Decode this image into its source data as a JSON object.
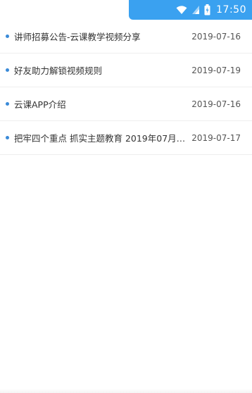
{
  "status_bar": {
    "time": "17:50",
    "icons": [
      "wifi-icon",
      "signal-icon",
      "battery-icon"
    ],
    "background_color": "#3aa1f0"
  },
  "notices": [
    {
      "title": "讲师招募公告-云课教学视频分享",
      "date": "2019-07-16"
    },
    {
      "title": "好友助力解锁视频规则",
      "date": "2019-07-19"
    },
    {
      "title": "云课APP介绍",
      "date": "2019-07-16"
    },
    {
      "title": "把牢四个重点 抓实主题教育  2019年07月17...",
      "date": "2019-07-17"
    }
  ],
  "colors": {
    "bullet": "#3a8ad8",
    "divider": "#eeeeee",
    "title_text": "#333333",
    "date_text": "#555555"
  }
}
